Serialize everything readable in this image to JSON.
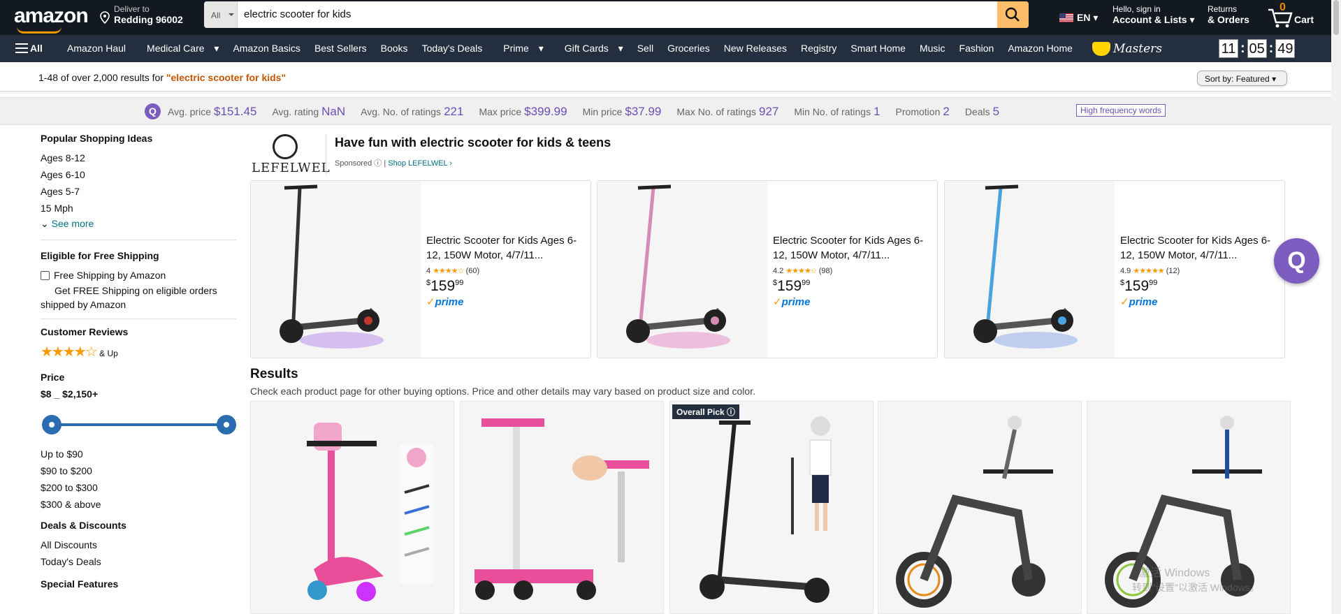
{
  "header": {
    "logo": "amazon",
    "deliver_line1": "Deliver to",
    "deliver_line2": "Redding 96002",
    "search_category": "All",
    "search_query": "electric scooter for kids",
    "lang": "EN",
    "account_line1": "Hello, sign in",
    "account_line2": "Account & Lists",
    "returns_line1": "Returns",
    "returns_line2": "& Orders",
    "cart_count": "0",
    "cart_label": "Cart"
  },
  "nav": {
    "all": "All",
    "items": [
      "Amazon Haul",
      "Medical Care",
      "Amazon Basics",
      "Best Sellers",
      "Books",
      "Today's Deals",
      "Prime",
      "Gift Cards",
      "Sell",
      "Groceries",
      "New Releases",
      "Registry",
      "Smart Home",
      "Music",
      "Fashion",
      "Amazon Home"
    ],
    "promo": "Masters",
    "clock": [
      "11",
      "05",
      "49"
    ]
  },
  "results_bar": {
    "prefix": "1-48 of over 2,000 results for ",
    "query": "\"electric scooter for kids\"",
    "sort_label": "Sort by:",
    "sort_value": "Featured"
  },
  "stats": {
    "items": [
      {
        "label": "Avg. price",
        "value": "$151.45"
      },
      {
        "label": "Avg. rating",
        "value": "NaN"
      },
      {
        "label": "Avg. No. of ratings",
        "value": "221"
      },
      {
        "label": "Max price",
        "value": "$399.99"
      },
      {
        "label": "Min price",
        "value": "$37.99"
      },
      {
        "label": "Max No. of ratings",
        "value": "927"
      },
      {
        "label": "Min No. of ratings",
        "value": "1"
      },
      {
        "label": "Promotion",
        "value": "2"
      },
      {
        "label": "Deals",
        "value": "5"
      }
    ],
    "hfw": "High frequency words"
  },
  "sidebar": {
    "ideas_title": "Popular Shopping Ideas",
    "ideas": [
      "Ages 8-12",
      "Ages 6-10",
      "Ages 5-7",
      "15 Mph"
    ],
    "see_more": "See more",
    "shipping_title": "Eligible for Free Shipping",
    "shipping_option": "Free Shipping by Amazon",
    "shipping_note": "Get FREE Shipping on eligible orders shipped by Amazon",
    "reviews_title": "Customer Reviews",
    "reviews_up": "& Up",
    "price_title": "Price",
    "price_range": "$8 _ $2,150+",
    "price_options": [
      "Up to $90",
      "$90 to $200",
      "$200 to $300",
      "$300 & above"
    ],
    "deals_title": "Deals & Discounts",
    "deals": [
      "All Discounts",
      "Today's Deals"
    ],
    "special_title": "Special Features"
  },
  "sponsored": {
    "brand": "LEFELWEL",
    "title": "Have fun with electric scooter for kids & teens",
    "sponsored_label": "Sponsored",
    "shop_link": "Shop LEFELWEL ›",
    "products": [
      {
        "title": "Electric Scooter for Kids Ages 6-12, 150W Motor, 4/7/11...",
        "rating": "4",
        "count": "(60)",
        "price_whole": "159",
        "price_frac": "99",
        "color": "#c0392b"
      },
      {
        "title": "Electric Scooter for Kids Ages 6-12, 150W Motor, 4/7/11...",
        "rating": "4.2",
        "count": "(98)",
        "price_whole": "159",
        "price_frac": "99",
        "color": "#d48bb7"
      },
      {
        "title": "Electric Scooter for Kids Ages 6-12, 150W Motor, 4/7/11...",
        "rating": "4.9",
        "count": "(12)",
        "price_whole": "159",
        "price_frac": "99",
        "color": "#4aa3df"
      }
    ],
    "prime": "prime"
  },
  "results": {
    "title": "Results",
    "subtitle": "Check each product page for other buying options. Price and other details may vary based on product size and color.",
    "overall_pick": "Overall Pick"
  },
  "watermark": {
    "line1": "激活 Windows",
    "line2": "转到\"设置\"以激活 Windows。"
  }
}
